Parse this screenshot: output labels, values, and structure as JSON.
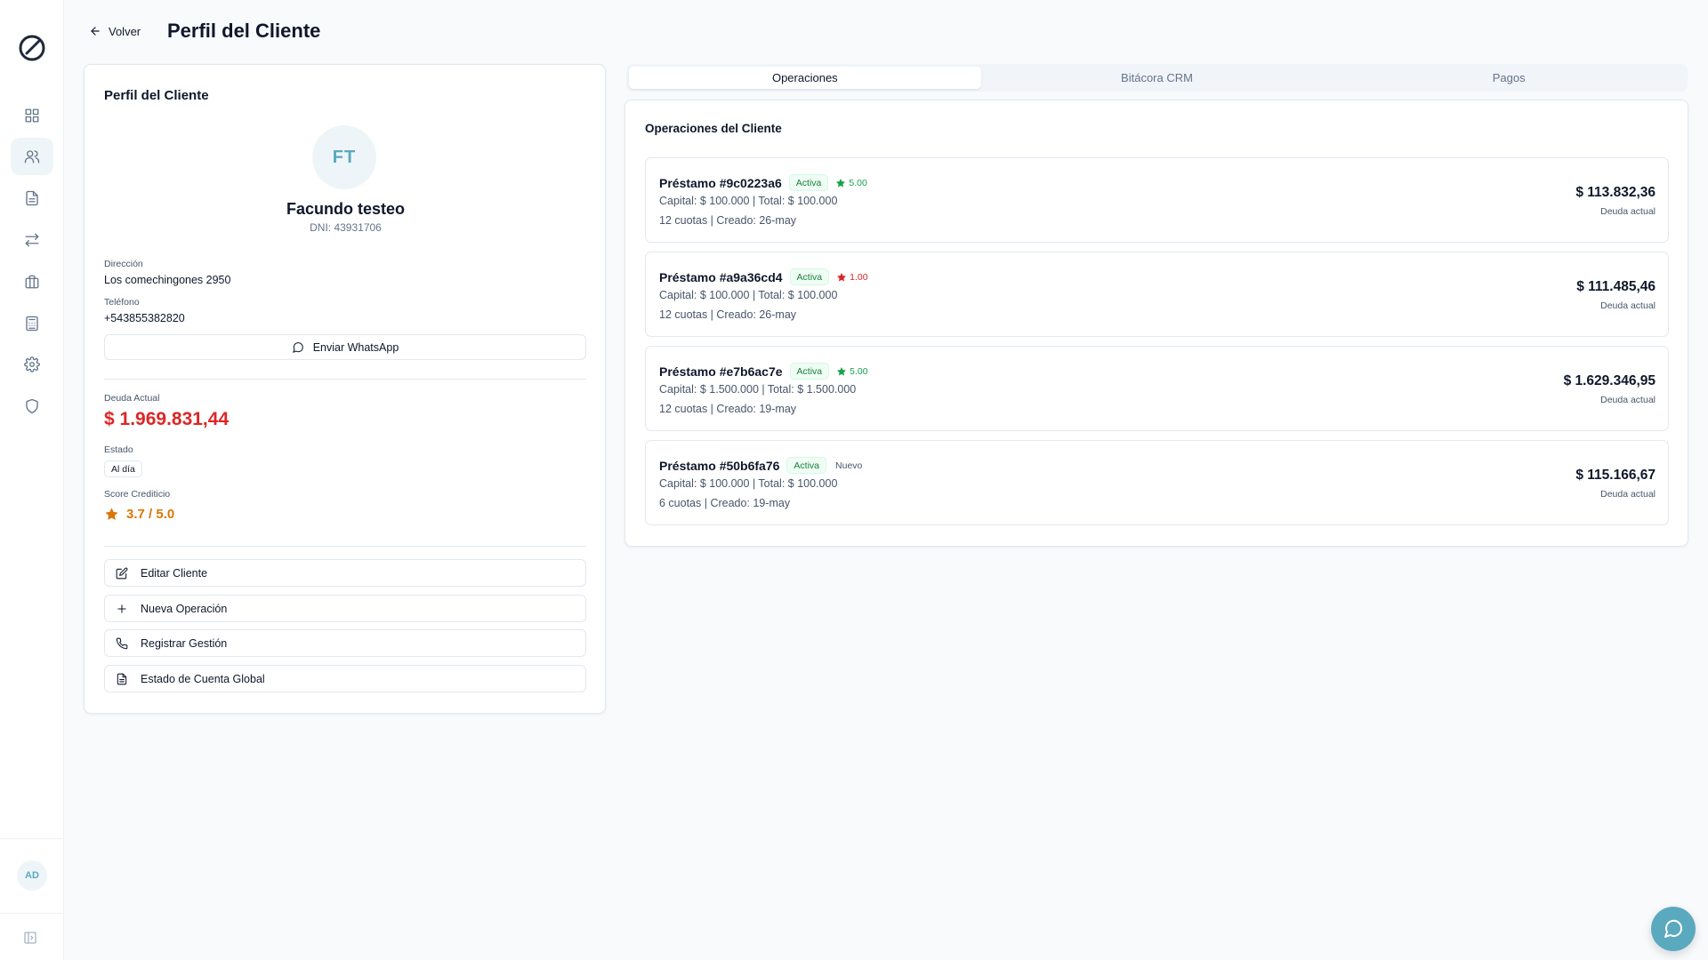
{
  "header": {
    "back_label": "Volver",
    "title": "Perfil del Cliente"
  },
  "sidebar": {
    "items": [
      {
        "icon": "dashboard-icon"
      },
      {
        "icon": "users-icon",
        "active": true
      },
      {
        "icon": "document-icon"
      },
      {
        "icon": "transfer-icon"
      },
      {
        "icon": "briefcase-icon"
      },
      {
        "icon": "calculator-icon"
      },
      {
        "icon": "gear-icon"
      },
      {
        "icon": "shield-icon"
      }
    ],
    "user_initials": "AD"
  },
  "profile": {
    "card_title": "Perfil del Cliente",
    "initials": "FT",
    "name": "Facundo testeo",
    "dni": "DNI: 43931706",
    "address_label": "Dirección",
    "address": "Los comechingones 2950",
    "phone_label": "Teléfono",
    "phone": "+543855382820",
    "whatsapp_label": "Enviar WhatsApp",
    "debt_label": "Deuda Actual",
    "debt": "$ 1.969.831,44",
    "state_label": "Estado",
    "state": "Al día",
    "score_label": "Score Crediticio",
    "score": "3.7 / 5.0",
    "actions": {
      "edit": "Editar Cliente",
      "new_op": "Nueva Operación",
      "register": "Registrar Gestión",
      "statement": "Estado de Cuenta Global"
    }
  },
  "tabs": [
    {
      "label": "Operaciones",
      "active": true
    },
    {
      "label": "Bitácora CRM"
    },
    {
      "label": "Pagos"
    }
  ],
  "operations": {
    "title": "Operaciones del Cliente",
    "items": [
      {
        "name": "Préstamo #9c0223a6",
        "status": "Activa",
        "rating": "5.00",
        "rating_color": "#16a34a",
        "line1": "Capital: $ 100.000 | Total: $ 100.000",
        "line2": "12 cuotas | Creado: 26-may",
        "amount": "$ 113.832,36",
        "amount_label": "Deuda actual"
      },
      {
        "name": "Préstamo #a9a36cd4",
        "status": "Activa",
        "rating": "1.00",
        "rating_color": "#dc2626",
        "line1": "Capital: $ 100.000 | Total: $ 100.000",
        "line2": "12 cuotas | Creado: 26-may",
        "amount": "$ 111.485,46",
        "amount_label": "Deuda actual"
      },
      {
        "name": "Préstamo #e7b6ac7e",
        "status": "Activa",
        "rating": "5.00",
        "rating_color": "#16a34a",
        "line1": "Capital: $ 1.500.000 | Total: $ 1.500.000",
        "line2": "12 cuotas | Creado: 19-may",
        "amount": "$ 1.629.346,95",
        "amount_label": "Deuda actual"
      },
      {
        "name": "Préstamo #50b6fa76",
        "status": "Activa",
        "tag": "Nuevo",
        "line1": "Capital: $ 100.000 | Total: $ 100.000",
        "line2": "6 cuotas | Creado: 19-may",
        "amount": "$ 115.166,67",
        "amount_label": "Deuda actual"
      }
    ]
  },
  "colors": {
    "accent": "#5aa9bf",
    "danger": "#dc2626",
    "warning": "#d97706",
    "success": "#16a34a"
  }
}
